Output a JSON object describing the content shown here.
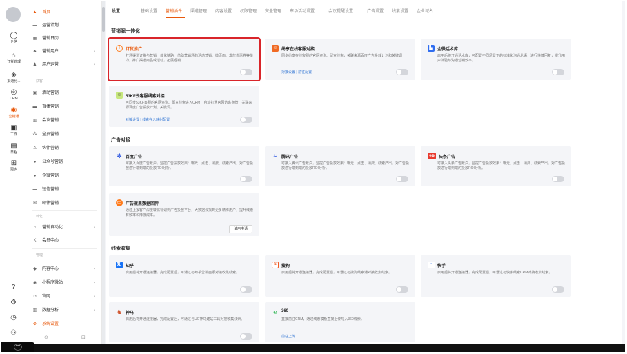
{
  "rail": {
    "items": [
      {
        "icon": "chat-icon",
        "label": "企信"
      },
      {
        "icon": "store-icon",
        "label": "订货管理"
      },
      {
        "icon": "cube-icon",
        "label": "渠道分..."
      },
      {
        "icon": "crm-icon",
        "label": "CRM"
      },
      {
        "icon": "marketing-icon",
        "label": "营销通"
      },
      {
        "icon": "calendar-icon",
        "label": "工作"
      },
      {
        "icon": "date-icon",
        "label": "日程"
      },
      {
        "icon": "grid-icon",
        "label": "更多"
      }
    ],
    "bottom_icons": [
      "help-icon",
      "settings-icon",
      "clock-icon",
      "contacts-icon",
      "more-icon"
    ]
  },
  "sidebar": {
    "items": [
      {
        "icon": "home-icon",
        "label": "首页",
        "chevron": false,
        "active": false
      },
      {
        "icon": "plan-icon",
        "label": "运营计划",
        "chevron": false,
        "active": false
      },
      {
        "icon": "calendar-icon",
        "label": "营销日历",
        "chevron": false,
        "active": false
      },
      {
        "icon": "users-icon",
        "label": "营销用户",
        "chevron": true,
        "active": false
      },
      {
        "icon": "user-ops-icon",
        "label": "用户运营",
        "chevron": true,
        "active": false
      }
    ],
    "section_huoke": "获客",
    "huoke_items": [
      {
        "icon": "activity-icon",
        "label": "活动营销"
      },
      {
        "icon": "live-icon",
        "label": "直播营销"
      },
      {
        "icon": "meeting-icon",
        "label": "会议营销"
      },
      {
        "icon": "staff-icon",
        "label": "全员营销"
      },
      {
        "icon": "partner-icon",
        "label": "伙伴营销"
      },
      {
        "icon": "wechat-icon",
        "label": "公众号营销"
      },
      {
        "icon": "wecom-icon",
        "label": "企微营销"
      },
      {
        "icon": "sms-icon",
        "label": "短信营销"
      },
      {
        "icon": "mail-icon",
        "label": "邮件营销"
      }
    ],
    "section_zhuanhua": "转化",
    "zhuanhua_items": [
      {
        "icon": "automation-icon",
        "label": "营销自动化",
        "chevron": true
      },
      {
        "icon": "member-icon",
        "label": "会员中心",
        "chevron": false
      }
    ],
    "section_guanli": "管理",
    "guanli_items": [
      {
        "icon": "content-icon",
        "label": "内容中心",
        "chevron": true,
        "active": false
      },
      {
        "icon": "miniprogram-icon",
        "label": "小程序微站",
        "chevron": true,
        "active": false
      },
      {
        "icon": "website-icon",
        "label": "官网",
        "chevron": true,
        "active": false
      },
      {
        "icon": "analytics-icon",
        "label": "数据分析",
        "chevron": true,
        "active": false
      },
      {
        "icon": "settings-icon",
        "label": "系统设置",
        "chevron": false,
        "active": true
      }
    ]
  },
  "topnav": {
    "title": "设置",
    "tabs": [
      "基础设置",
      "营销插件",
      "渠道管理",
      "内容设置",
      "权限管理",
      "安全管理",
      "市场活动设置",
      "会议提醒设置",
      "广告设置",
      "线索设置",
      "企业域名"
    ],
    "active": "营销插件"
  },
  "sections": {
    "yingxiao": "营销服一体化",
    "guanggao": "广告对接",
    "xiansuo": "线索收集"
  },
  "cards": {
    "dinghuo": {
      "icon": "box-icon",
      "title": "订货推广",
      "desc": "打通渠道订货与营销一体化链路，借助营销通的活动营销、微页面、发放优惠券等能力，推广渠道商品或活动，拓展经销"
    },
    "share": {
      "icon": "service-icon",
      "title": "纷享在线客服对接",
      "desc": "同步纷享在线客服的官网咨询、留言线索，关联来源百度广告投放计划和关键词",
      "link": "对接设置 | 前往配置"
    },
    "wecom": {
      "icon": "library-icon",
      "title": "企微话术库",
      "desc": "启用后将开通话术库，可配置不同场景下的标准化沟通术语，进行快捷回复，提升用户体验与沟通营销效率。"
    },
    "kf53": {
      "icon": "kf53-icon",
      "title": "53KF云客服线索对接",
      "desc": "可同步53KF客服的官网咨询、留言线索进入CRM，自动打通官网访客身份，关联来源百度广告投放计划、关键词。",
      "link": "对接设置 | 线索存入映射配置"
    },
    "baidu": {
      "icon": "baidu-icon",
      "title": "百度广告",
      "desc": "可接入百度广告账户，监控广告投放效果：曝光、点击、消费、线索产出，对广告投放进行端到端的投放ROI分析。"
    },
    "tencent": {
      "icon": "tencent-icon",
      "title": "腾讯广告",
      "desc": "可接入腾讯广告账户，监控广告投放效果：曝光、点击、消费、线索产出，对广告投放进行端到端的投放ROI分析。"
    },
    "toutiao": {
      "icon": "toutiao-icon",
      "icon_text": "头条",
      "title": "头条广告",
      "desc": "可接入头条广告账户，监控广告投放效果：曝光、点击、消费、线索产出，对广告投放进行端到端的投放ROI分析。"
    },
    "effect": {
      "icon": "feedback-icon",
      "title": "广告效果数据回传",
      "desc": "通过上报客户深度转化标记到广告投放平台，大数据会找到更多精准用户，提升线索有效率和降低成本。",
      "button": "试用申请"
    },
    "zhihu": {
      "icon": "zhihu-icon",
      "icon_text": "知",
      "title": "知乎",
      "desc": "启用后将开通连接器，完成配置后，可通过与知乎营销画报对接收集线索。"
    },
    "sogou": {
      "icon": "sogou-icon",
      "icon_text": "S",
      "title": "搜狗",
      "desc": "启用后将开通连接器，完成配置后，可通过与搜狗线索通对接收集线索。"
    },
    "kuaishou": {
      "icon": "kuaishou-icon",
      "title": "快手",
      "desc": "启用后将开通连接器，完成配置后，可通过与快手线索CRM对接收集线索。"
    },
    "shenma": {
      "icon": "shenma-icon",
      "title": "神马",
      "desc": "启用后将开通连接器，完成配置后，可通过与UC神马建站工具对接收集线索。"
    },
    "s360": {
      "icon": "360-icon",
      "title": "360",
      "desc": "直接前往CRM，通过线索模板直接上传导入360线索。",
      "link": "前往上传"
    }
  },
  "colors": {
    "accent": "#e8590c",
    "link": "#3a7bd5",
    "highlight_border": "#d9252a"
  }
}
